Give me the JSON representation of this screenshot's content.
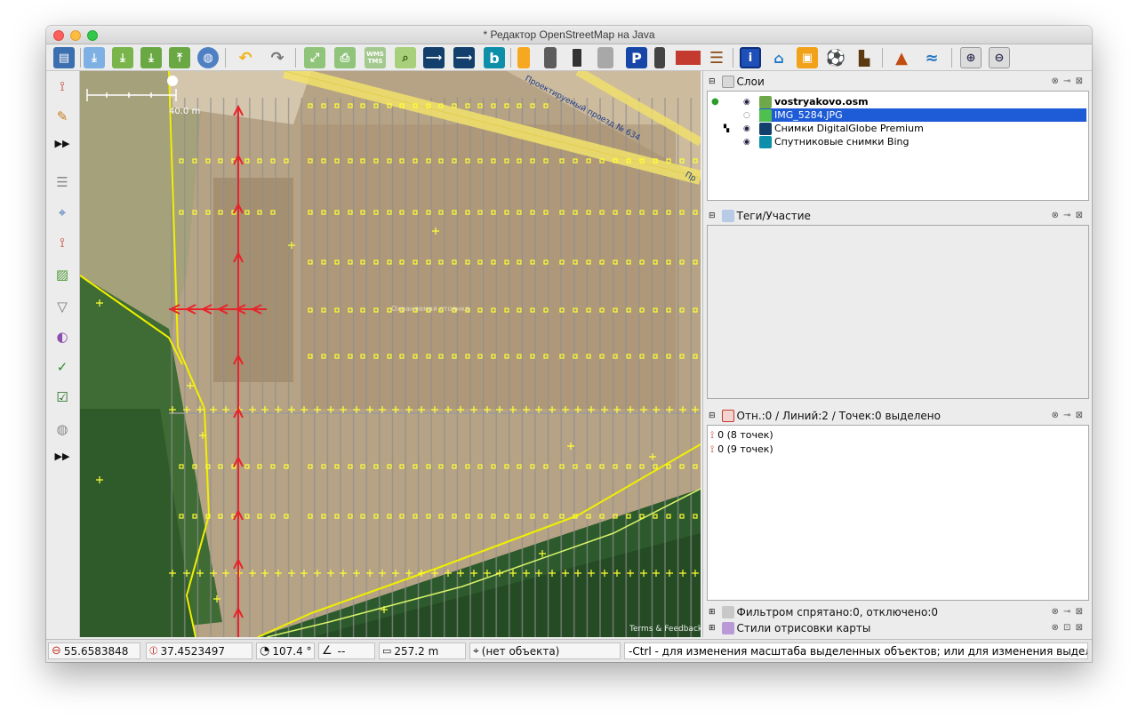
{
  "window": {
    "title": "* Редактор OpenStreetMap на Java"
  },
  "colors": {
    "accent_selection": "#1e5bd6",
    "track_red": "#e8242a",
    "node_yellow": "#ffff33",
    "way_gray": "#8c8c8c"
  },
  "toolbar": {
    "buttons": [
      "open-file-icon",
      "download-icon",
      "download-area-icon",
      "download-layer-icon",
      "upload-icon",
      "globe-icon",
      "undo-icon",
      "redo-icon",
      "zoom-fit-icon",
      "print-icon",
      "wms-icon",
      "search-icon",
      "imagery-icon",
      "imagery-alt-icon",
      "bing-icon",
      "road-tag-icon",
      "road-dashed-icon",
      "road-double-icon",
      "road-gray-icon",
      "parking-icon",
      "traffic-light-icon",
      "wall-icon",
      "railway-icon",
      "info-icon",
      "hotel-icon",
      "shop-icon",
      "football-icon",
      "factory-icon",
      "mountain-icon",
      "river-icon",
      "zoom-in-icon",
      "zoom-out-icon"
    ],
    "wms_label": "WMS TMS",
    "parking_label": "P",
    "info_label": "i",
    "bing_label": "b"
  },
  "left_toolbar": {
    "tools": [
      "draw-way-icon",
      "pencil-icon",
      "more-icon",
      "layers-icon",
      "tag-icon",
      "relation-icon",
      "image-icon",
      "filter-icon",
      "palette-icon",
      "validator-icon",
      "checklist-icon",
      "globe-icon",
      "more-icon"
    ]
  },
  "map": {
    "scale_label": "40.0 m",
    "attribution": "Terms & Feedback",
    "street_label": "Проектируемый проезд № 634",
    "street_label_2": "Пр"
  },
  "layers_panel": {
    "title": "Слои",
    "items": [
      {
        "name": "vostryakovo.osm",
        "active": true,
        "selected": false,
        "visible": true
      },
      {
        "name": "IMG_5284.JPG",
        "active": false,
        "selected": true,
        "visible": false
      },
      {
        "name": "Снимки DigitalGlobe Premium",
        "active": false,
        "selected": false,
        "visible": true
      },
      {
        "name": "Спутниковые снимки Bing",
        "active": false,
        "selected": false,
        "visible": true
      }
    ]
  },
  "tags_panel": {
    "title": "Теги/Участие"
  },
  "selection_panel": {
    "title": "Отн.:0 / Линий:2 / Точек:0 выделено",
    "items": [
      "0 (8 точек)",
      "0 (9 точек)"
    ]
  },
  "filter_panel": {
    "title": "Фильтром спрятано:0, отключено:0"
  },
  "style_panel": {
    "title": "Стили отрисовки карты"
  },
  "status": {
    "lat": "55.6583848",
    "lon": "37.4523497",
    "heading": "107.4 °",
    "angle": "--",
    "distance": "257.2 m",
    "object": "(нет объекта)",
    "message": "-Ctrl - для изменения масштаба выделенных объектов; или для изменения выделения"
  }
}
